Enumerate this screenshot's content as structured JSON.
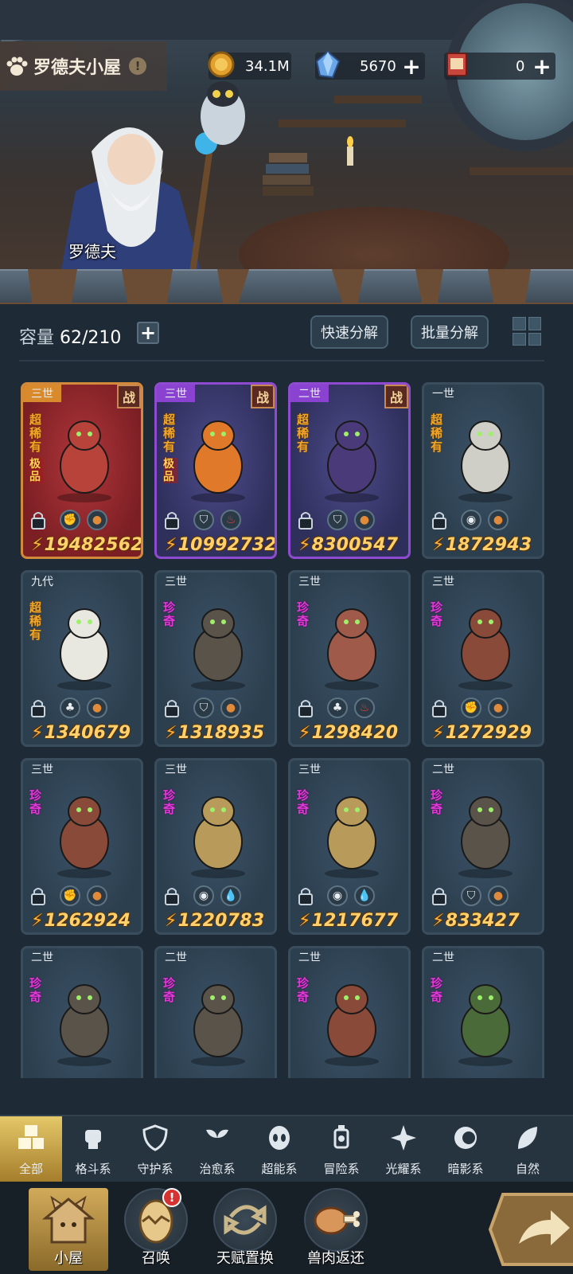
{
  "header": {
    "title": "罗德夫小屋",
    "info_icon": "info-icon",
    "character_name": "罗德夫"
  },
  "resources": [
    {
      "name": "gold-coin",
      "value": "34.1M",
      "has_plus": false
    },
    {
      "name": "crystal",
      "value": "5670",
      "has_plus": true
    },
    {
      "name": "ticket",
      "value": "0",
      "has_plus": true
    }
  ],
  "panel": {
    "capacity_label": "容量",
    "capacity_value": "62/210",
    "quick_decompose": "快速分解",
    "batch_decompose": "批量分解"
  },
  "cards": [
    {
      "tier": "三世",
      "rarity": "超稀有",
      "peak": "极品",
      "battle": "战",
      "style": "red",
      "badges": [
        "fist-icon",
        "meat-icon"
      ],
      "power": "19482562"
    },
    {
      "tier": "三世",
      "rarity": "超稀有",
      "peak": "极品",
      "battle": "战",
      "style": "purple",
      "badges": [
        "shield-icon",
        "fire-icon"
      ],
      "power": "10992732"
    },
    {
      "tier": "二世",
      "rarity": "超稀有",
      "peak": "",
      "battle": "战",
      "style": "purple",
      "badges": [
        "shield-icon",
        "meat-icon"
      ],
      "power": "8300547"
    },
    {
      "tier": "一世",
      "rarity": "超稀有",
      "peak": "",
      "battle": "",
      "style": "normal",
      "badges": [
        "alien-icon",
        "meat-icon"
      ],
      "power": "1872943"
    },
    {
      "tier": "九代",
      "rarity": "超稀有",
      "peak": "",
      "battle": "",
      "style": "normal",
      "badges": [
        "sprout-icon",
        "meat-icon"
      ],
      "power": "1340679"
    },
    {
      "tier": "三世",
      "rarity": "珍奇",
      "peak": "",
      "battle": "",
      "style": "normal",
      "badges": [
        "shield-icon",
        "meat-icon"
      ],
      "power": "1318935"
    },
    {
      "tier": "三世",
      "rarity": "珍奇",
      "peak": "",
      "battle": "",
      "style": "normal",
      "badges": [
        "sprout-icon",
        "fire-icon"
      ],
      "power": "1298420"
    },
    {
      "tier": "三世",
      "rarity": "珍奇",
      "peak": "",
      "battle": "",
      "style": "normal",
      "badges": [
        "fist-icon",
        "meat-icon"
      ],
      "power": "1272929"
    },
    {
      "tier": "三世",
      "rarity": "珍奇",
      "peak": "",
      "battle": "",
      "style": "normal",
      "badges": [
        "fist-icon",
        "meat-icon"
      ],
      "power": "1262924"
    },
    {
      "tier": "三世",
      "rarity": "珍奇",
      "peak": "",
      "battle": "",
      "style": "normal",
      "badges": [
        "alien-icon",
        "water-icon"
      ],
      "power": "1220783"
    },
    {
      "tier": "三世",
      "rarity": "珍奇",
      "peak": "",
      "battle": "",
      "style": "normal",
      "badges": [
        "alien-icon",
        "water-icon"
      ],
      "power": "1217677"
    },
    {
      "tier": "二世",
      "rarity": "珍奇",
      "peak": "",
      "battle": "",
      "style": "normal",
      "badges": [
        "shield-icon",
        "meat-icon"
      ],
      "power": "833427"
    },
    {
      "tier": "二世",
      "rarity": "珍奇",
      "peak": "",
      "battle": "",
      "style": "normal",
      "badges": [],
      "power": ""
    },
    {
      "tier": "二世",
      "rarity": "珍奇",
      "peak": "",
      "battle": "",
      "style": "normal",
      "badges": [],
      "power": ""
    },
    {
      "tier": "二世",
      "rarity": "珍奇",
      "peak": "",
      "battle": "",
      "style": "normal",
      "badges": [],
      "power": ""
    },
    {
      "tier": "二世",
      "rarity": "珍奇",
      "peak": "",
      "battle": "",
      "style": "normal",
      "badges": [],
      "power": ""
    }
  ],
  "categories": [
    {
      "label": "全部",
      "icon": "grid-blocks-icon",
      "active": true
    },
    {
      "label": "格斗系",
      "icon": "fist-icon"
    },
    {
      "label": "守护系",
      "icon": "shield-icon"
    },
    {
      "label": "治愈系",
      "icon": "sprout-icon"
    },
    {
      "label": "超能系",
      "icon": "alien-icon"
    },
    {
      "label": "冒险系",
      "icon": "lantern-icon"
    },
    {
      "label": "光耀系",
      "icon": "compass-star-icon"
    },
    {
      "label": "暗影系",
      "icon": "eclipse-icon"
    },
    {
      "label": "自然",
      "icon": "leaf-icon"
    }
  ],
  "nav": [
    {
      "label": "小屋",
      "icon": "house-icon",
      "active": true
    },
    {
      "label": "召唤",
      "icon": "egg-icon",
      "alert": "!"
    },
    {
      "label": "天赋置换",
      "icon": "swap-icon"
    },
    {
      "label": "兽肉返还",
      "icon": "meat-bone-icon"
    }
  ],
  "colors": {
    "panel_bg": "#1e2a35",
    "card_bg": "#2c3f4f",
    "power_text": "#ffd06b",
    "super_rare": "#f3a625",
    "rare": "#e13ad8",
    "active_tab": "#e4c869"
  }
}
